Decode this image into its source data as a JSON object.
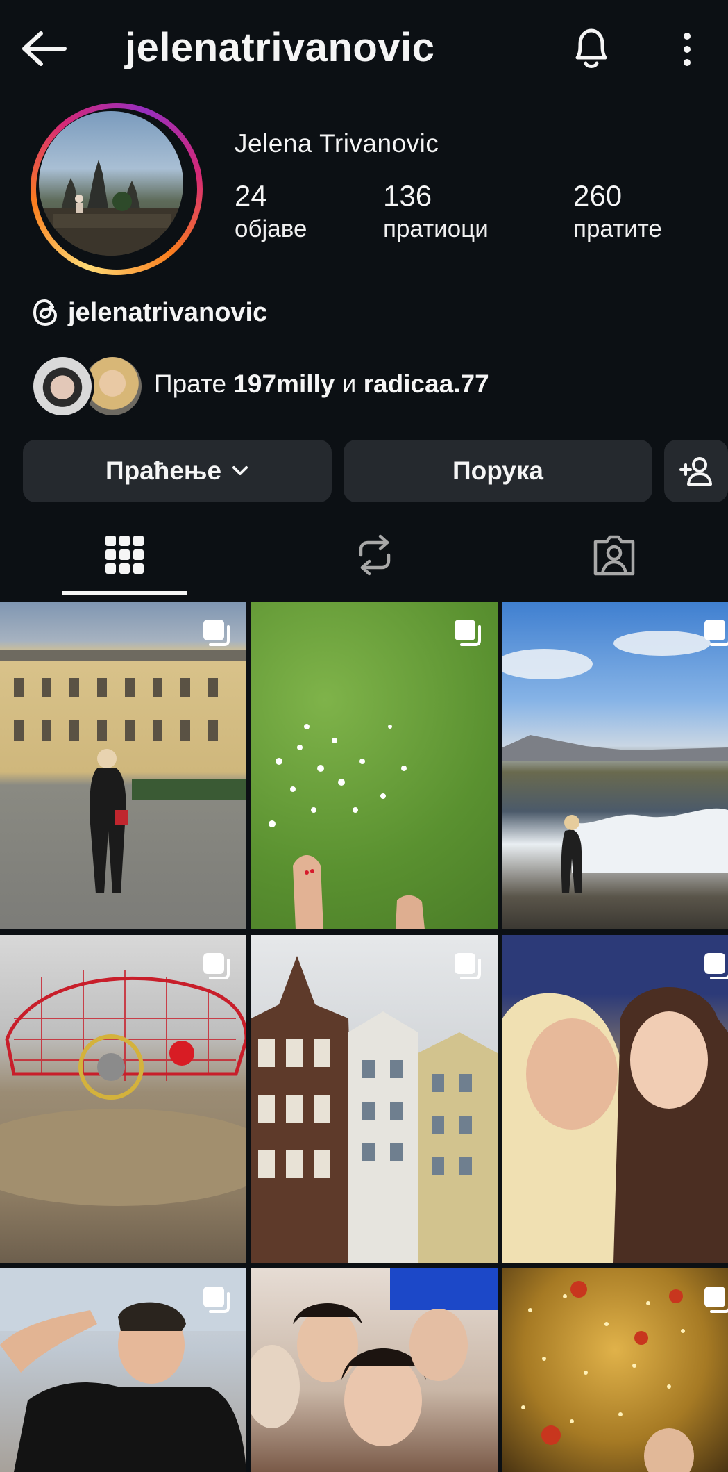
{
  "header": {
    "username": "jelenatrivanovic",
    "back_icon": "arrow-left-icon",
    "bell_icon": "bell-icon",
    "more_icon": "more-vertical-icon"
  },
  "profile": {
    "full_name": "Jelena Trivanovic",
    "stats": [
      {
        "value": "24",
        "label": "објаве"
      },
      {
        "value": "136",
        "label": "пратиоци"
      },
      {
        "value": "260",
        "label": "пратите"
      }
    ],
    "threads_handle": "jelenatrivanovic",
    "followed_by_prefix": "Прате",
    "followed_by_user1": "197milly",
    "followed_by_conj": "и",
    "followed_by_user2": "radicaa.77"
  },
  "actions": {
    "following_label": "Праћење",
    "message_label": "Порука"
  },
  "colors": {
    "background": "#0c1014",
    "button": "#25292e",
    "text": "#f5f5f5"
  }
}
